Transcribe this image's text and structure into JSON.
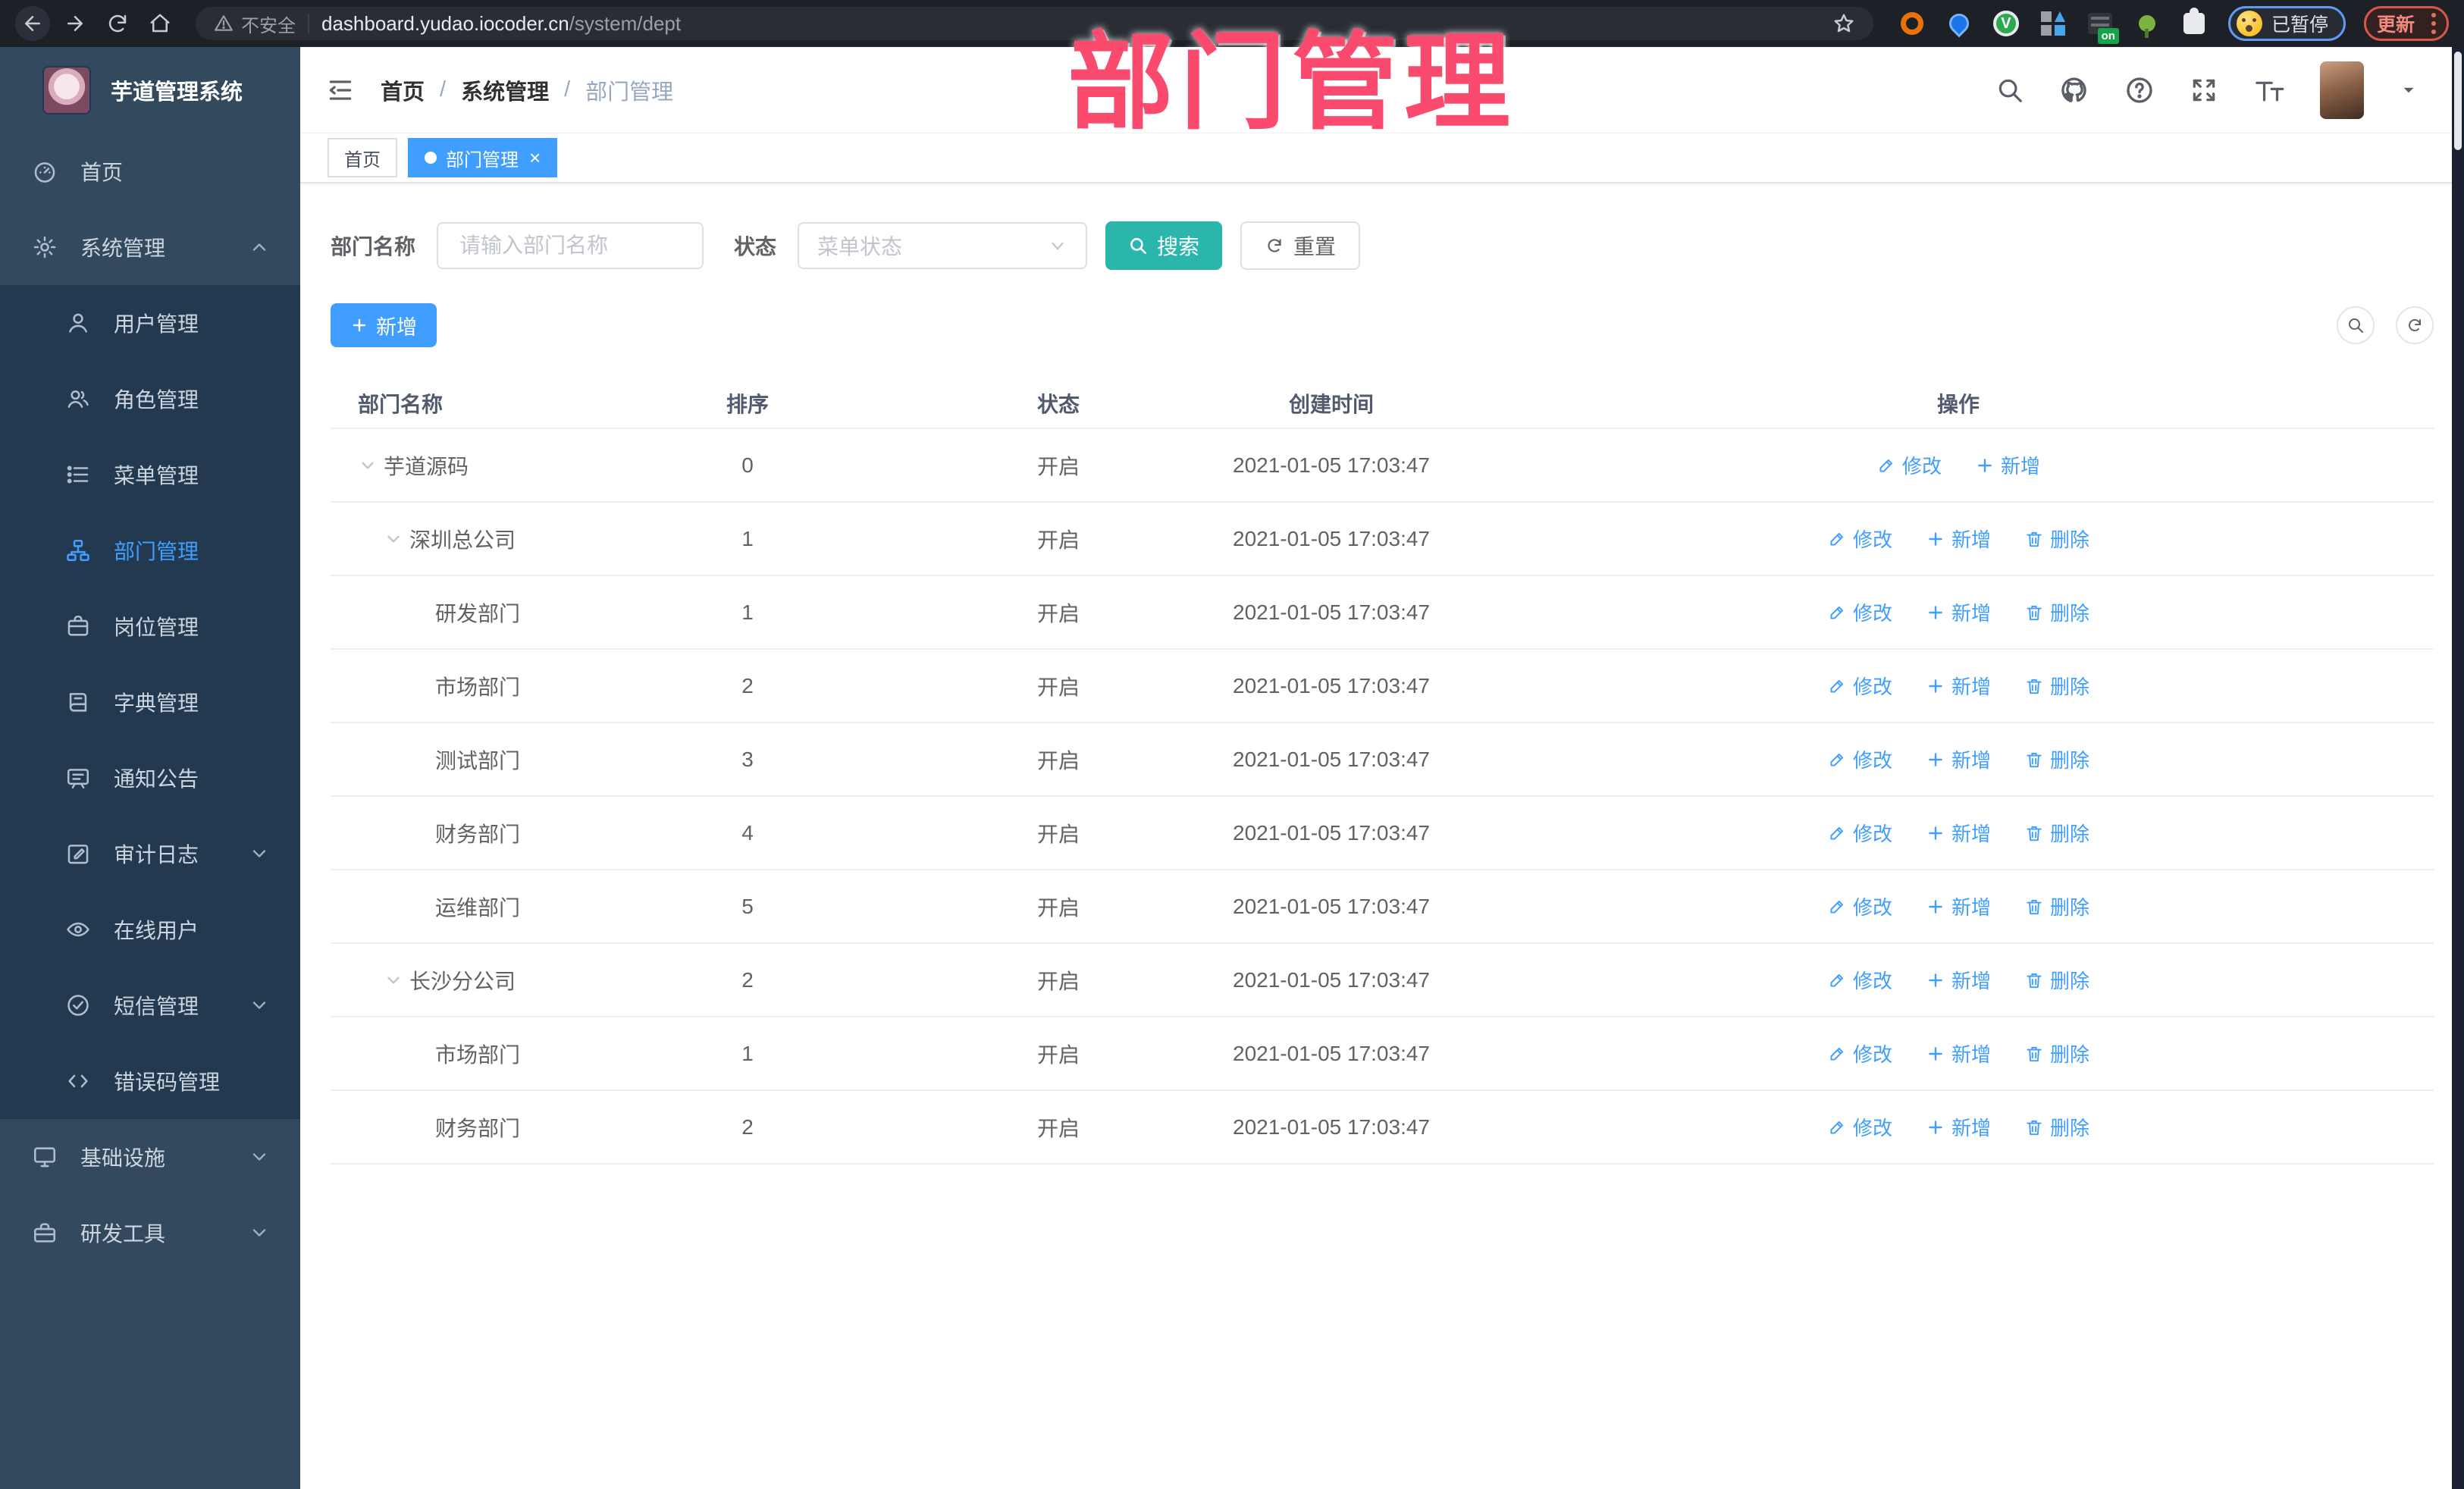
{
  "colors": {
    "primary": "#409EFF",
    "search_teal": "#2BB6AB",
    "watermark_pink": "#FA4A6D",
    "sidebar_bg": "#33495E",
    "submenu_bg": "#223950",
    "tab_active": "#409EFF"
  },
  "browser": {
    "security_label": "不安全",
    "url_host": "dashboard.yudao.iocoder.cn",
    "url_path": "/system/dept",
    "profile_status": "已暂停",
    "update_label": "更新"
  },
  "watermark": {
    "text": "部门管理"
  },
  "sidebar": {
    "title": "芋道管理系统",
    "menu": [
      {
        "label": "首页",
        "icon": "dashboard-icon",
        "level": "top"
      },
      {
        "label": "系统管理",
        "icon": "gear-icon",
        "level": "top",
        "chevron": "up"
      },
      {
        "label": "用户管理",
        "icon": "user-icon",
        "level": "sub"
      },
      {
        "label": "角色管理",
        "icon": "role-icon",
        "level": "sub"
      },
      {
        "label": "菜单管理",
        "icon": "menu-list-icon",
        "level": "sub"
      },
      {
        "label": "部门管理",
        "icon": "dept-tree-icon",
        "level": "sub",
        "active": true
      },
      {
        "label": "岗位管理",
        "icon": "post-icon",
        "level": "sub"
      },
      {
        "label": "字典管理",
        "icon": "dict-icon",
        "level": "sub"
      },
      {
        "label": "通知公告",
        "icon": "notice-icon",
        "level": "sub"
      },
      {
        "label": "审计日志",
        "icon": "audit-icon",
        "level": "sub",
        "chevron": "down"
      },
      {
        "label": "在线用户",
        "icon": "online-user-icon",
        "level": "sub"
      },
      {
        "label": "短信管理",
        "icon": "sms-icon",
        "level": "sub",
        "chevron": "down"
      },
      {
        "label": "错误码管理",
        "icon": "error-code-icon",
        "level": "sub"
      },
      {
        "label": "基础设施",
        "icon": "infra-icon",
        "level": "top",
        "chevron": "down"
      },
      {
        "label": "研发工具",
        "icon": "devtool-icon",
        "level": "top",
        "chevron": "down"
      }
    ]
  },
  "navbar": {
    "breadcrumb": [
      "首页",
      "系统管理",
      "部门管理"
    ]
  },
  "tabs": [
    {
      "label": "首页",
      "active": false
    },
    {
      "label": "部门管理",
      "active": true,
      "closable": true
    }
  ],
  "filter": {
    "name_label": "部门名称",
    "name_placeholder": "请输入部门名称",
    "status_label": "状态",
    "status_placeholder": "菜单状态",
    "search_label": "搜索",
    "reset_label": "重置"
  },
  "toolbar": {
    "add_label": "新增"
  },
  "table": {
    "headers": [
      "部门名称",
      "排序",
      "状态",
      "创建时间",
      "操作"
    ],
    "action_labels": {
      "edit": "修改",
      "add": "新增",
      "delete": "删除"
    },
    "rows": [
      {
        "name": "芋道源码",
        "level": 0,
        "caret": true,
        "sort": "0",
        "status": "开启",
        "created": "2021-01-05 17:03:47",
        "can_delete": false
      },
      {
        "name": "深圳总公司",
        "level": 1,
        "caret": true,
        "sort": "1",
        "status": "开启",
        "created": "2021-01-05 17:03:47",
        "can_delete": true
      },
      {
        "name": "研发部门",
        "level": 2,
        "caret": false,
        "sort": "1",
        "status": "开启",
        "created": "2021-01-05 17:03:47",
        "can_delete": true
      },
      {
        "name": "市场部门",
        "level": 2,
        "caret": false,
        "sort": "2",
        "status": "开启",
        "created": "2021-01-05 17:03:47",
        "can_delete": true
      },
      {
        "name": "测试部门",
        "level": 2,
        "caret": false,
        "sort": "3",
        "status": "开启",
        "created": "2021-01-05 17:03:47",
        "can_delete": true
      },
      {
        "name": "财务部门",
        "level": 2,
        "caret": false,
        "sort": "4",
        "status": "开启",
        "created": "2021-01-05 17:03:47",
        "can_delete": true
      },
      {
        "name": "运维部门",
        "level": 2,
        "caret": false,
        "sort": "5",
        "status": "开启",
        "created": "2021-01-05 17:03:47",
        "can_delete": true
      },
      {
        "name": "长沙分公司",
        "level": 1,
        "caret": true,
        "sort": "2",
        "status": "开启",
        "created": "2021-01-05 17:03:47",
        "can_delete": true
      },
      {
        "name": "市场部门",
        "level": 2,
        "caret": false,
        "sort": "1",
        "status": "开启",
        "created": "2021-01-05 17:03:47",
        "can_delete": true
      },
      {
        "name": "财务部门",
        "level": 2,
        "caret": false,
        "sort": "2",
        "status": "开启",
        "created": "2021-01-05 17:03:47",
        "can_delete": true
      }
    ]
  }
}
